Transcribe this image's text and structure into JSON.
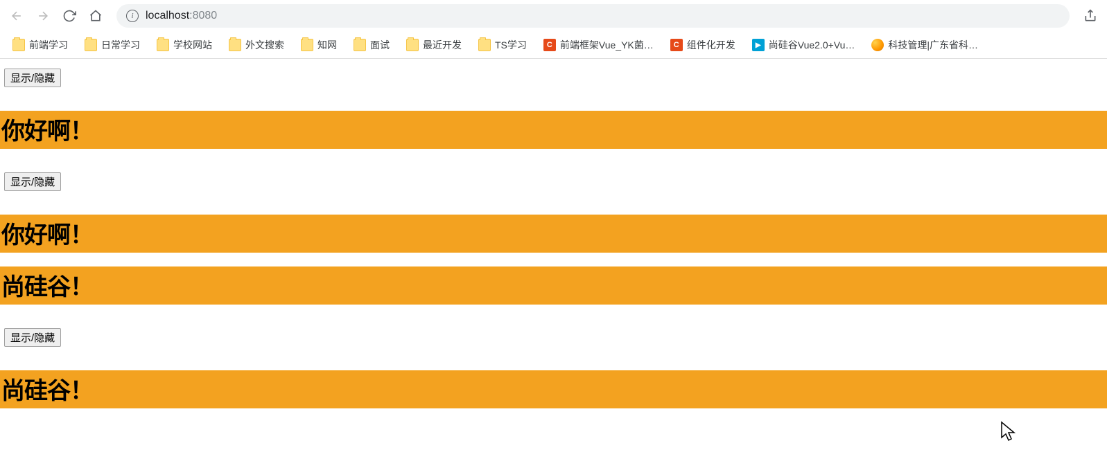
{
  "browser": {
    "url_host": "localhost",
    "url_port": ":8080"
  },
  "bookmarks": [
    {
      "icon": "folder",
      "label": "前端学习"
    },
    {
      "icon": "folder",
      "label": "日常学习"
    },
    {
      "icon": "folder",
      "label": "学校网站"
    },
    {
      "icon": "folder",
      "label": "外文搜索"
    },
    {
      "icon": "folder",
      "label": "知网"
    },
    {
      "icon": "folder",
      "label": "面试"
    },
    {
      "icon": "folder",
      "label": "最近开发"
    },
    {
      "icon": "folder",
      "label": "TS学习"
    },
    {
      "icon": "csdn",
      "label": "前端框架Vue_YK菌…"
    },
    {
      "icon": "csdn",
      "label": "组件化开发"
    },
    {
      "icon": "bili",
      "label": "尚硅谷Vue2.0+Vu…"
    },
    {
      "icon": "globe",
      "label": "科技管理|广东省科…"
    }
  ],
  "page": {
    "toggle_label": "显示/隐藏",
    "headings": [
      "你好啊！",
      "你好啊！",
      "尚硅谷！",
      "尚硅谷！"
    ]
  }
}
